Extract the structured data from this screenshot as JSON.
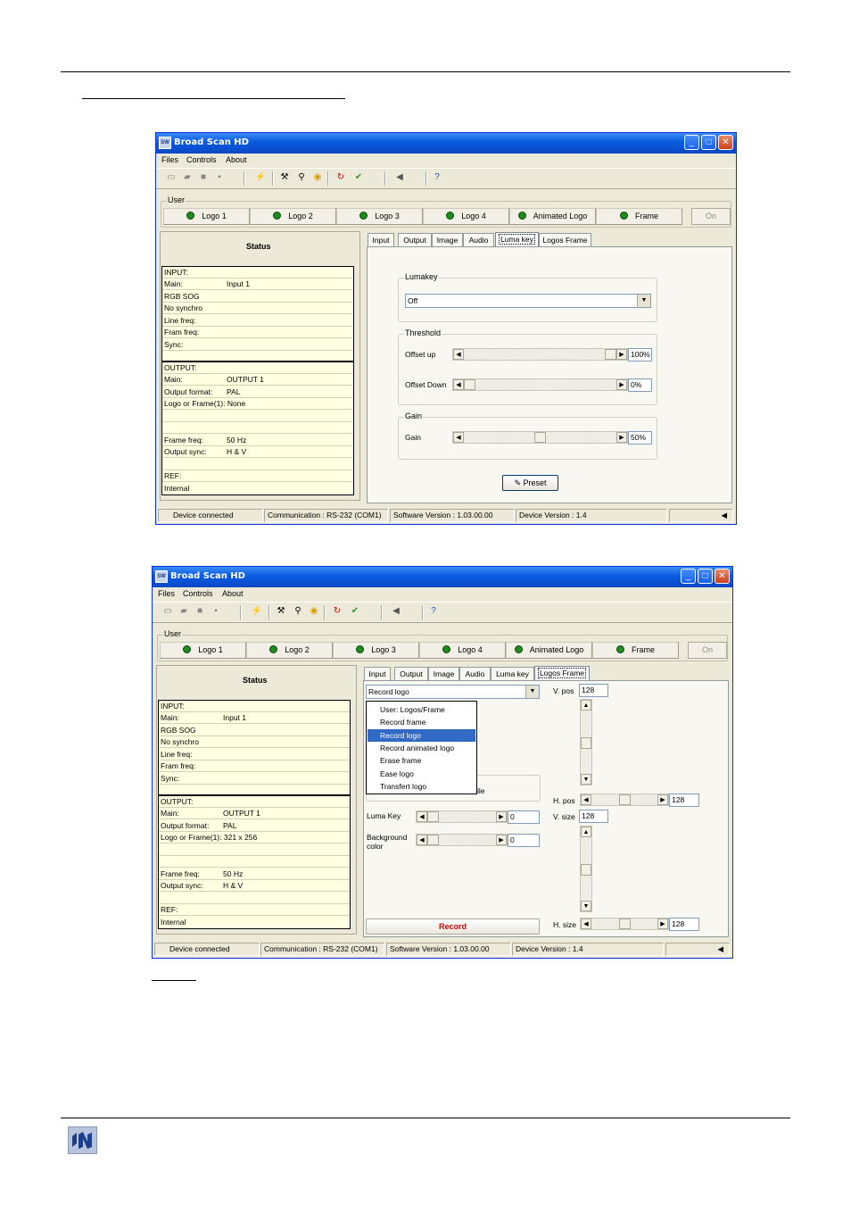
{
  "window": {
    "title": "Broad Scan HD",
    "menu": [
      "Files",
      "Controls",
      "About"
    ]
  },
  "user_group": {
    "label": "User",
    "logos": [
      "Logo 1",
      "Logo 2",
      "Logo 3",
      "Logo 4",
      "Animated Logo",
      "Frame"
    ],
    "on_label": "On"
  },
  "status": {
    "title": "Status",
    "input": {
      "header": "INPUT:",
      "main_label": "Main:",
      "main_value": "Input 1",
      "lines": [
        "RGB SOG",
        "No synchro",
        "Line freq:",
        "Fram freq:",
        "Sync:"
      ]
    },
    "output": {
      "header": "OUTPUT:",
      "main_label": "Main:",
      "main_value": "OUTPUT 1",
      "format_label": "Output format:",
      "format_value": "PAL",
      "logo_label_1": "Logo or Frame(1): None",
      "logo_label_2": "Logo or Frame(1): 321 x 256",
      "frame_freq_label": "Frame freq:",
      "frame_freq_value": "50 Hz",
      "sync_label": "Output sync:",
      "sync_value": "H & V",
      "ref_label": "REF:",
      "ref_value": "Internal"
    }
  },
  "tabs": [
    "Input",
    "Output",
    "Image",
    "Audio",
    "Luma key",
    "Logos Frame"
  ],
  "lumakey_panel": {
    "lumakey_label": "Lumakey",
    "lumakey_value": "Off",
    "threshold_label": "Threshold",
    "offset_up_label": "Offset up",
    "offset_up_value": "100%",
    "offset_up_level": 1.0,
    "offset_down_label": "Offset Down",
    "offset_down_value": "0%",
    "offset_down_level": 0.0,
    "gain_group_label": "Gain",
    "gain_label": "Gain",
    "gain_value": "50%",
    "gain_level": 0.5,
    "preset_label": "Preset"
  },
  "logos_panel": {
    "combo_value": "Record logo",
    "dropdown_items": [
      "User: Logos/Frame",
      "Record frame",
      "Record logo",
      "Record animated logo",
      "Erase frame",
      "Ease logo",
      "Transfert logo"
    ],
    "selected_index": 2,
    "partial_label": "ile",
    "luma_key_label": "Luma Key",
    "luma_key_value": "0",
    "bg_color_label_1": "Background",
    "bg_color_label_2": "color",
    "bg_color_value": "0",
    "record_label": "Record",
    "v_pos_label": "V. pos",
    "v_pos_value": "128",
    "h_pos_label": "H. pos",
    "h_pos_value": "128",
    "v_size_label": "V. size",
    "v_size_value": "128",
    "h_size_label": "H. size",
    "h_size_value": "128"
  },
  "statusbar": {
    "device": "Device connected",
    "communication": "Communication : RS-232 (COM1)",
    "software": "Software Version : 1.03.00.00",
    "device_version": "Device Version : 1.4"
  },
  "colors": {
    "titlebar": "#0a5ae0",
    "info_bg": "#ffffe1",
    "record_text": "#d00000",
    "selection": "#316ac5"
  }
}
